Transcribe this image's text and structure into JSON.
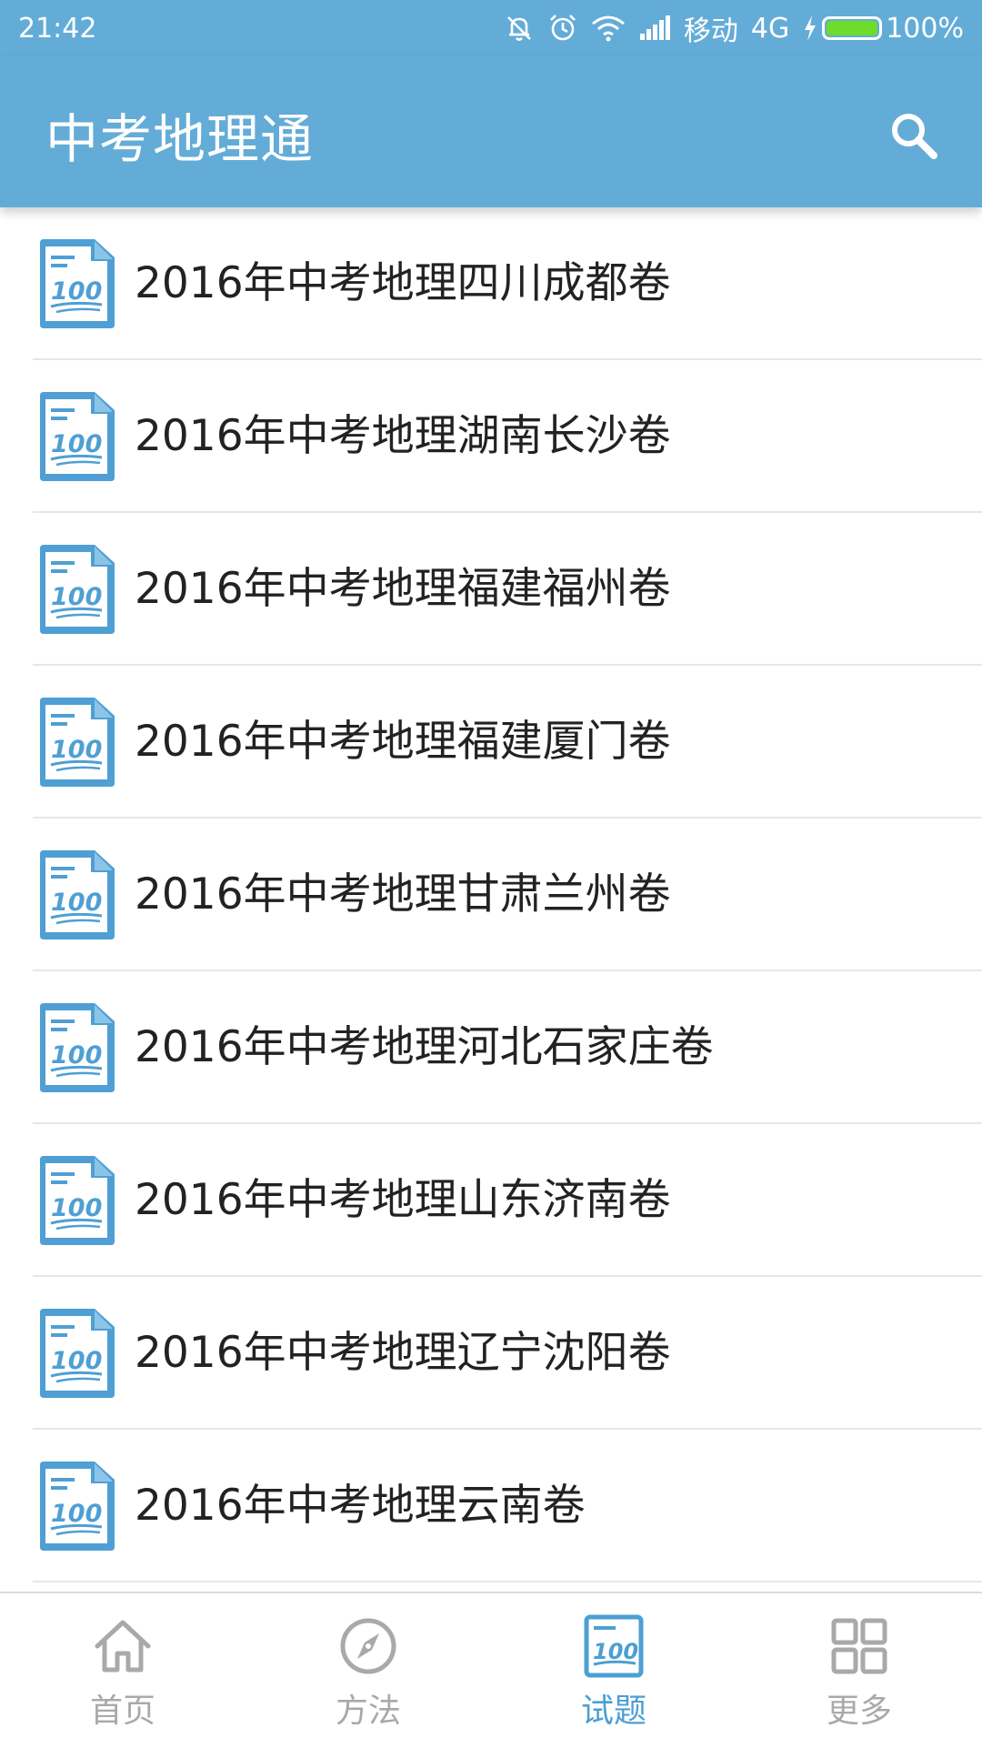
{
  "status_bar": {
    "time": "21:42",
    "carrier": "移动",
    "network": "4G",
    "battery": "100%",
    "icons": [
      "mute-icon",
      "alarm-icon",
      "wifi-icon",
      "signal-icon",
      "charging-icon",
      "battery-icon"
    ]
  },
  "app_bar": {
    "title": "中考地理通",
    "search_icon": "search-icon"
  },
  "list": {
    "icon": "exam-paper-100-icon",
    "items": [
      "2016年中考地理四川成都卷",
      "2016年中考地理湖南长沙卷",
      "2016年中考地理福建福州卷",
      "2016年中考地理福建厦门卷",
      "2016年中考地理甘肃兰州卷",
      "2016年中考地理河北石家庄卷",
      "2016年中考地理山东济南卷",
      "2016年中考地理辽宁沈阳卷",
      "2016年中考地理云南卷"
    ]
  },
  "bottom_nav": {
    "items": [
      {
        "label": "首页",
        "icon": "home-icon",
        "active": false
      },
      {
        "label": "方法",
        "icon": "compass-icon",
        "active": false
      },
      {
        "label": "试题",
        "icon": "exam-paper-100-icon",
        "active": true
      },
      {
        "label": "更多",
        "icon": "grid-icon",
        "active": false
      }
    ]
  },
  "colors": {
    "primary": "#63acd7",
    "active": "#4c9fd2",
    "inactive": "#a9a9a9",
    "text": "#222222",
    "battery": "#6ddc2b"
  }
}
